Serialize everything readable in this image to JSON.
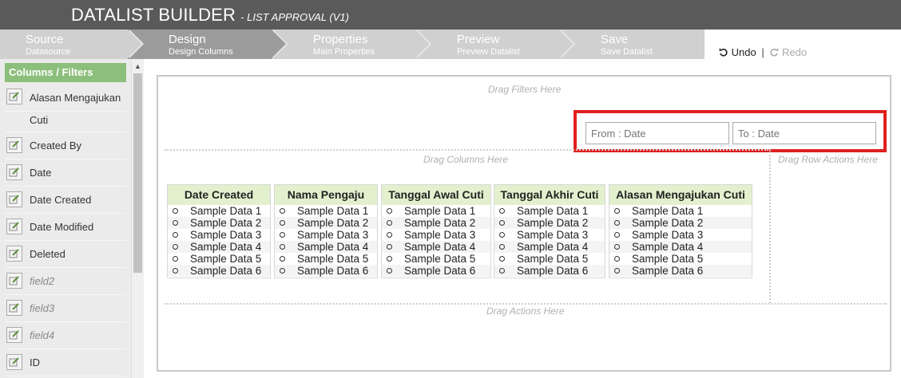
{
  "header": {
    "title": "DATALIST BUILDER",
    "subtitle": "- LIST APPROVAL (V1)"
  },
  "steps": [
    {
      "label": "Source",
      "sub": "Datasource"
    },
    {
      "label": "Design",
      "sub": "Design Columns"
    },
    {
      "label": "Properties",
      "sub": "Main Properties"
    },
    {
      "label": "Preview",
      "sub": "Preview Datalist"
    },
    {
      "label": "Save",
      "sub": "Save Datalist"
    }
  ],
  "toolbar": {
    "undo": "Undo",
    "separator": "|",
    "redo": "Redo"
  },
  "sidebar": {
    "heading": "Columns / Filters",
    "items": [
      {
        "label": "Alasan Mengajukan"
      },
      {
        "label": "Cuti"
      },
      {
        "label": "Created By"
      },
      {
        "label": "Date"
      },
      {
        "label": "Date Created"
      },
      {
        "label": "Date Modified"
      },
      {
        "label": "Deleted"
      },
      {
        "label": "field2"
      },
      {
        "label": "field3"
      },
      {
        "label": "field4"
      },
      {
        "label": "ID"
      }
    ]
  },
  "canvas": {
    "filters_hint": "Drag Filters Here",
    "columns_hint": "Drag Columns Here",
    "row_actions_hint": "Drag Row Actions Here",
    "actions_hint": "Drag Actions Here",
    "filters": {
      "from_placeholder": "From : Date",
      "to_placeholder": "To : Date"
    },
    "columns": [
      {
        "header": "Date Created",
        "rows": [
          "Sample Data 1",
          "Sample Data 2",
          "Sample Data 3",
          "Sample Data 4",
          "Sample Data 5",
          "Sample Data 6"
        ]
      },
      {
        "header": "Nama Pengaju",
        "rows": [
          "Sample Data 1",
          "Sample Data 2",
          "Sample Data 3",
          "Sample Data 4",
          "Sample Data 5",
          "Sample Data 6"
        ]
      },
      {
        "header": "Tanggal Awal Cuti",
        "rows": [
          "Sample Data 1",
          "Sample Data 2",
          "Sample Data 3",
          "Sample Data 4",
          "Sample Data 5",
          "Sample Data 6"
        ]
      },
      {
        "header": "Tanggal Akhir Cuti",
        "rows": [
          "Sample Data 1",
          "Sample Data 2",
          "Sample Data 3",
          "Sample Data 4",
          "Sample Data 5",
          "Sample Data 6"
        ]
      },
      {
        "header": "Alasan Mengajukan Cuti",
        "rows": [
          "Sample Data 1",
          "Sample Data 2",
          "Sample Data 3",
          "Sample Data 4",
          "Sample Data 5",
          "Sample Data 6"
        ]
      }
    ]
  },
  "colors": {
    "header_bg": "#5a5a5a",
    "step_bg": "#d0d0d0",
    "step_active": "#9b9b9b",
    "sidebar_heading": "#8dbf7c",
    "column_header": "#e2f0ce",
    "highlight": "#e02020"
  },
  "icons": {
    "field_icon": "edit-field-icon",
    "undo_icon": "undo-icon",
    "redo_icon": "redo-icon"
  }
}
